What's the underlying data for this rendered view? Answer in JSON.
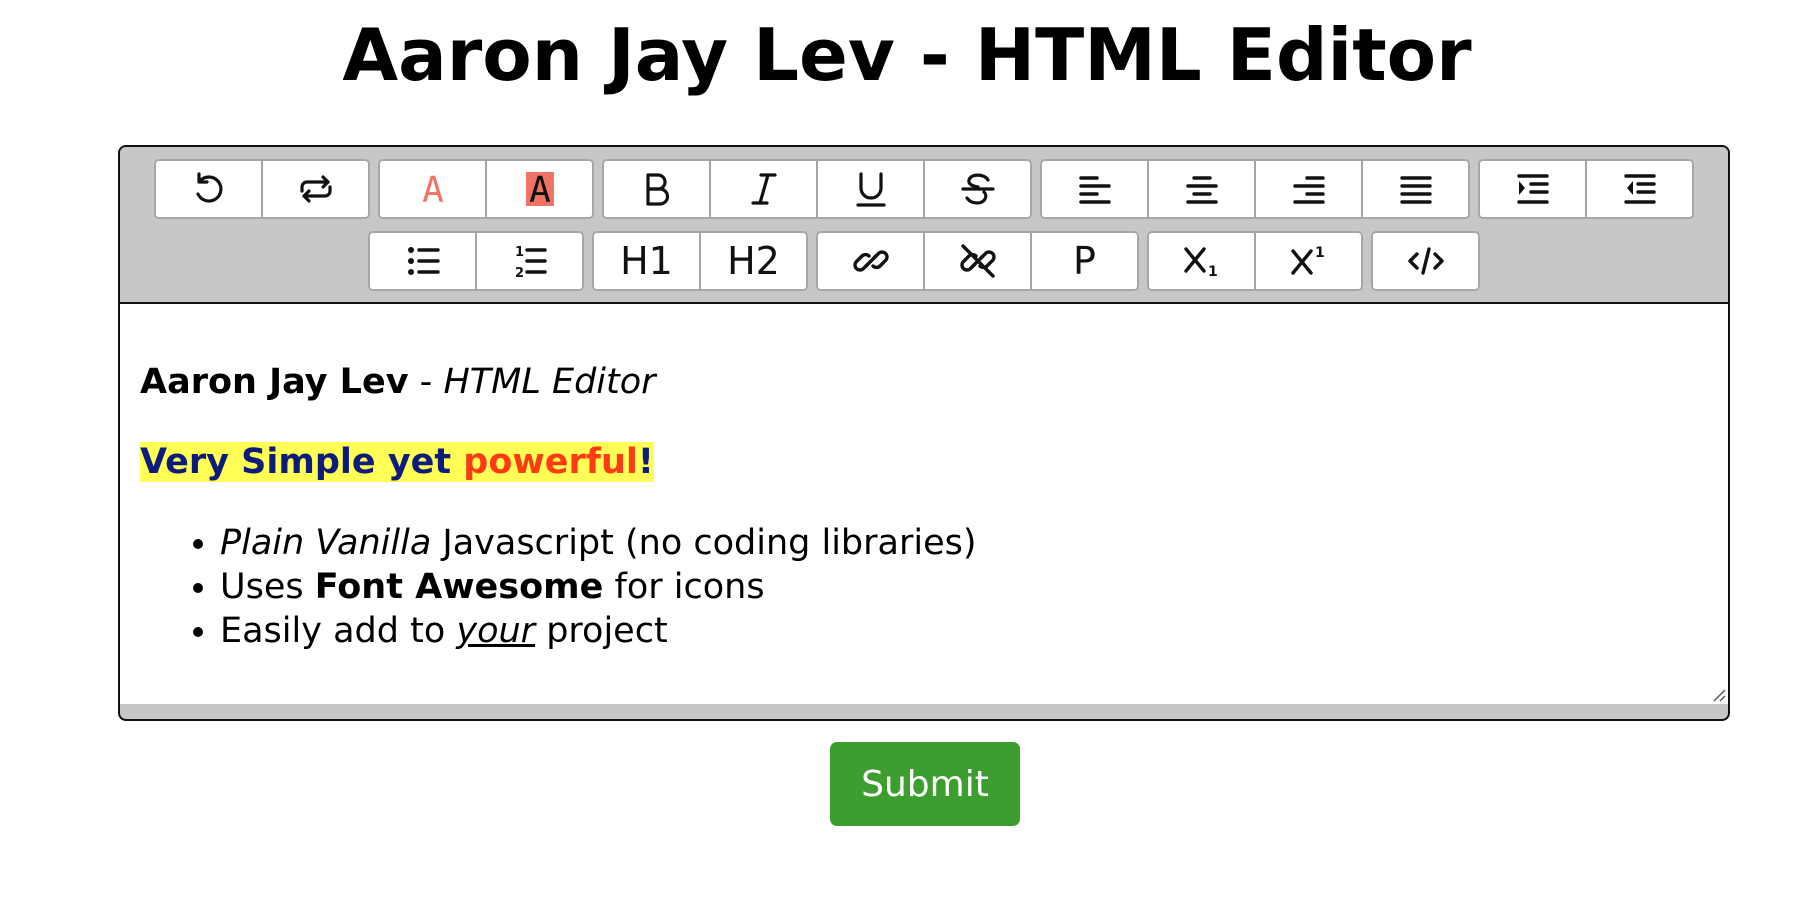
{
  "page": {
    "title": "Aaron Jay Lev - HTML Editor"
  },
  "toolbar": {
    "h1_label": "H1",
    "h2_label": "H2",
    "p_label": "P",
    "font_color": "#f07366",
    "highlight_color": "#f07366"
  },
  "content": {
    "line1_bold": "Aaron Jay Lev",
    "line1_sep": " - ",
    "line1_italic": "HTML Editor",
    "line2_part1": "Very Simple yet ",
    "line2_part2": "powerful",
    "line2_part3": "!",
    "highlight_color": "#ffff55",
    "text_color_blue": "#0d1b7a",
    "text_color_red": "#ff3a14",
    "list": [
      {
        "italic": "Plain Vanilla",
        "rest": " Javascript (no coding libraries)"
      },
      {
        "pre": "Uses ",
        "bold": "Font Awesome",
        "post": " for icons"
      },
      {
        "pre": "Easily add to ",
        "underline": "your",
        "post": " project"
      }
    ]
  },
  "submit": {
    "label": "Submit",
    "color": "#3c9e2e"
  }
}
